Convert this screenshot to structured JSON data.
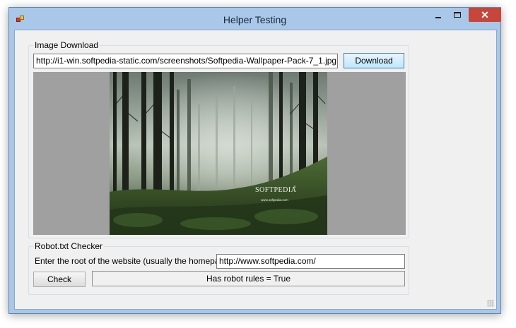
{
  "window": {
    "title": "Helper Testing"
  },
  "controls": {
    "minimize": "minimize",
    "maximize": "maximize",
    "close": "✕"
  },
  "image_download": {
    "group_label": "Image Download",
    "url_value": "http://i1-win.softpedia-static.com/screenshots/Softpedia-Wallpaper-Pack-7_1.jpg",
    "download_label": "Download",
    "picture": {
      "watermark": "SOFTPEDIA",
      "watermark_sup": "®",
      "watermark_url": "www.softpedia.com"
    }
  },
  "robot_checker": {
    "group_label": "Robot.txt Checker",
    "prompt_label": "Enter the root of the website (usually the homepage):",
    "url_value": "http://www.softpedia.com/",
    "check_label": "Check",
    "result_text": "Has robot rules = True"
  },
  "colors": {
    "accent_close": "#c7453a",
    "focus_border": "#3c7fb1",
    "image_background": "#a0a0a0"
  },
  "icons": {
    "app": "app-windows-icon",
    "resize": "resize-grip-icon"
  }
}
